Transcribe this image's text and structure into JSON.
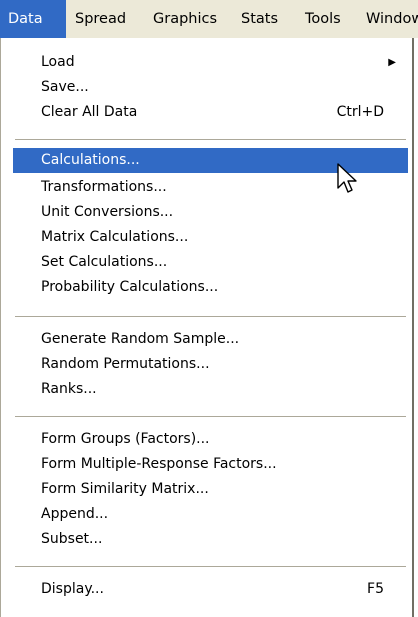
{
  "menubar": {
    "items": [
      {
        "label": "Data"
      },
      {
        "label": "Spread"
      },
      {
        "label": "Graphics"
      },
      {
        "label": "Stats"
      },
      {
        "label": "Tools"
      },
      {
        "label": "Window"
      }
    ]
  },
  "menu": {
    "load": {
      "label": "Load"
    },
    "save": {
      "label": "Save..."
    },
    "clear": {
      "label": "Clear All Data",
      "shortcut": "Ctrl+D"
    },
    "calculations": {
      "label": "Calculations..."
    },
    "transformations": {
      "label": "Transformations..."
    },
    "unit_conversions": {
      "label": "Unit Conversions..."
    },
    "matrix_calculations": {
      "label": "Matrix Calculations..."
    },
    "set_calculations": {
      "label": "Set Calculations..."
    },
    "probability_calculations": {
      "label": "Probability Calculations..."
    },
    "generate_random_sample": {
      "label": "Generate Random Sample..."
    },
    "random_permutations": {
      "label": "Random Permutations..."
    },
    "ranks": {
      "label": "Ranks..."
    },
    "form_groups": {
      "label": "Form Groups (Factors)..."
    },
    "form_multiple_response": {
      "label": "Form Multiple-Response Factors..."
    },
    "form_similarity_matrix": {
      "label": "Form Similarity Matrix..."
    },
    "append": {
      "label": "Append..."
    },
    "subset": {
      "label": "Subset..."
    },
    "display": {
      "label": "Display...",
      "shortcut": "F5"
    }
  },
  "colors": {
    "highlight": "#316ac5",
    "menubar_bg": "#ece9d8",
    "separator": "#aca899"
  }
}
